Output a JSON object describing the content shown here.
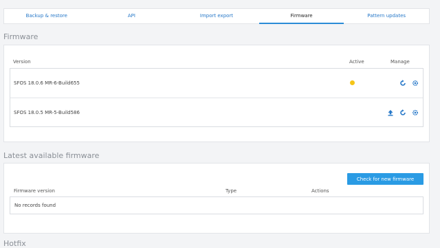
{
  "tabs": [
    {
      "label": "Backup & restore"
    },
    {
      "label": "API"
    },
    {
      "label": "Import export"
    },
    {
      "label": "Firmware"
    },
    {
      "label": "Pattern updates"
    }
  ],
  "active_tab": "Firmware",
  "firmware": {
    "title": "Firmware",
    "columns": {
      "version": "Version",
      "active": "Active",
      "manage": "Manage"
    },
    "rows": [
      {
        "version": "SFOS 18.0.6 MR-6-Build655",
        "active": true
      },
      {
        "version": "SFOS 18.0.5 MR-5-Build586",
        "active": false
      }
    ]
  },
  "latest": {
    "title": "Latest available firmware",
    "check_button": "Check for new firmware",
    "columns": {
      "firmware_version": "Firmware version",
      "type": "Type",
      "actions": "Actions"
    },
    "empty": "No records found"
  },
  "hotfix": {
    "title": "Hotfix"
  },
  "colors": {
    "accent": "#2a8bd6",
    "link": "#2577c8",
    "active_dot": "#f5c518",
    "button": "#2a9be4"
  }
}
